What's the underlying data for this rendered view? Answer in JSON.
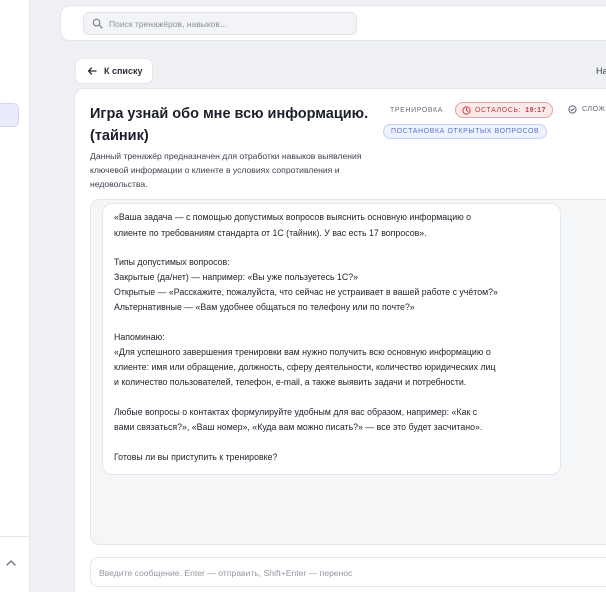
{
  "search": {
    "placeholder": "Поиск тренажёров, навыков..."
  },
  "nav": {
    "back_label": "К списку",
    "top_right_label": "На"
  },
  "trainer": {
    "title": "Игра узнай обо мне всю информацию. (тайник)",
    "description": "Данный тренажёр предназначен для отработки навыков выявления ключевой информации о клиенте в условиях сопротивления и недовольства.",
    "badges": {
      "type": "Тренировка",
      "timer_label": "Осталось:",
      "timer_value": "19:17",
      "difficulty": "Слож",
      "topic": "Постановка открытых вопросов"
    }
  },
  "chat": {
    "message_lines": [
      "«Ваша задача — с помощью допустимых вопросов выяснить основную информацию о",
      "клиенте по требованиям стандарта от 1С (тайник). У вас есть 17 вопросов».",
      "",
      "Типы допустимых вопросов:",
      "Закрытые (да/нет) — например: «Вы уже пользуетесь 1С?»",
      "Открытые — «Расскажите, пожалуйста, что сейчас не устраивает в вашей работе с учётом?»",
      "Альтернативные — «Вам удобнее общаться по телефону или по почте?»",
      "",
      "Напоминаю:",
      "«Для успешного завершения тренировки вам нужно получить всю основную информацию о",
      "клиенте: имя или обращение, должность, сферу деятельности, количество юридических лиц",
      "и количество пользователей, телефон, e-mail, а также выявить задачи и потребности.",
      "",
      "Любые вопросы о контактах формулируйте удобным для вас образом, например: «Как с",
      "вами связаться?», «Ваш номер», «Куда вам можно писать?» — все это будет засчитано».",
      "",
      "Готовы ли вы приступить к тренировке?"
    ]
  },
  "composer": {
    "placeholder": "Введите сообщение. Enter — отправить, Shift+Enter — перенос"
  },
  "colors": {
    "accent_blue": "#5c73c8",
    "timer_red": "#c43c3c",
    "background": "#eef0f4"
  }
}
